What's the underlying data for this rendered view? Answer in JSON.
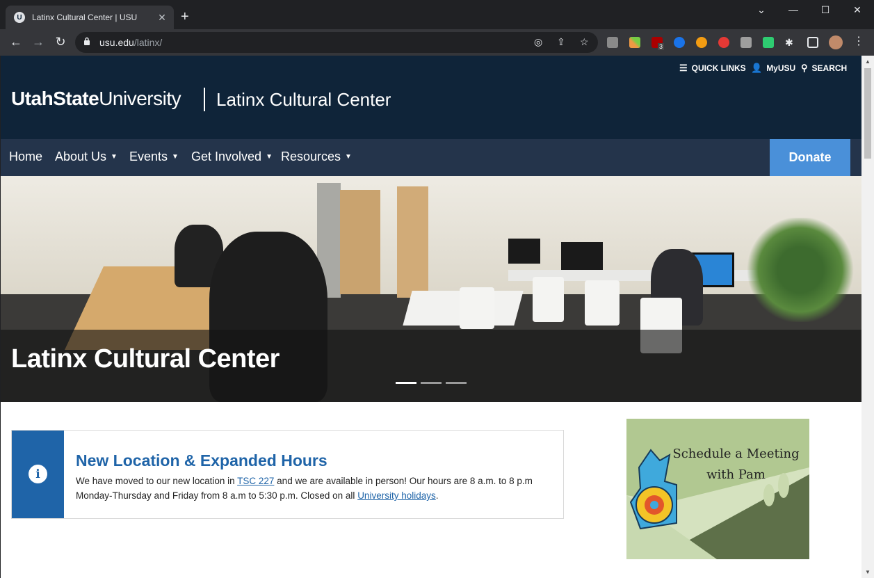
{
  "browser": {
    "tab_title": "Latinx Cultural Center | USU",
    "url_host": "usu.edu",
    "url_path": "/latinx/",
    "extension_badge": "3"
  },
  "site": {
    "utility_links": [
      {
        "label": "QUICK LINKS",
        "icon": "list-icon"
      },
      {
        "label": "MyUSU",
        "icon": "user-icon"
      },
      {
        "label": "SEARCH",
        "icon": "search-icon"
      }
    ],
    "logo_bold": "UtahState",
    "logo_light": "University",
    "site_name": "Latinx Cultural Center",
    "nav": [
      "Home",
      "About Us",
      "Events",
      "Get Involved",
      "Resources"
    ],
    "donate_label": "Donate"
  },
  "hero": {
    "title": "Latinx Cultural Center",
    "slides": 3,
    "active_slide": 1
  },
  "notice": {
    "heading": "New Location & Expanded Hours",
    "text_1": "We have moved to our new location in ",
    "link_1": "TSC 227",
    "text_2": " and we are available in person! Our hours are 8 a.m. to 8 p.m Monday-Thursday and Friday from 8 a.m to 5:30 p.m. Closed on all ",
    "link_2": "University holidays",
    "text_3": "."
  },
  "promo": {
    "line1": "Schedule a Meeting",
    "line2": "with Pam"
  },
  "colors": {
    "header_navy": "#0f2439",
    "nav_bar": "#24344b",
    "donate_blue": "#4a90d9",
    "usu_blue": "#1f64a8"
  }
}
